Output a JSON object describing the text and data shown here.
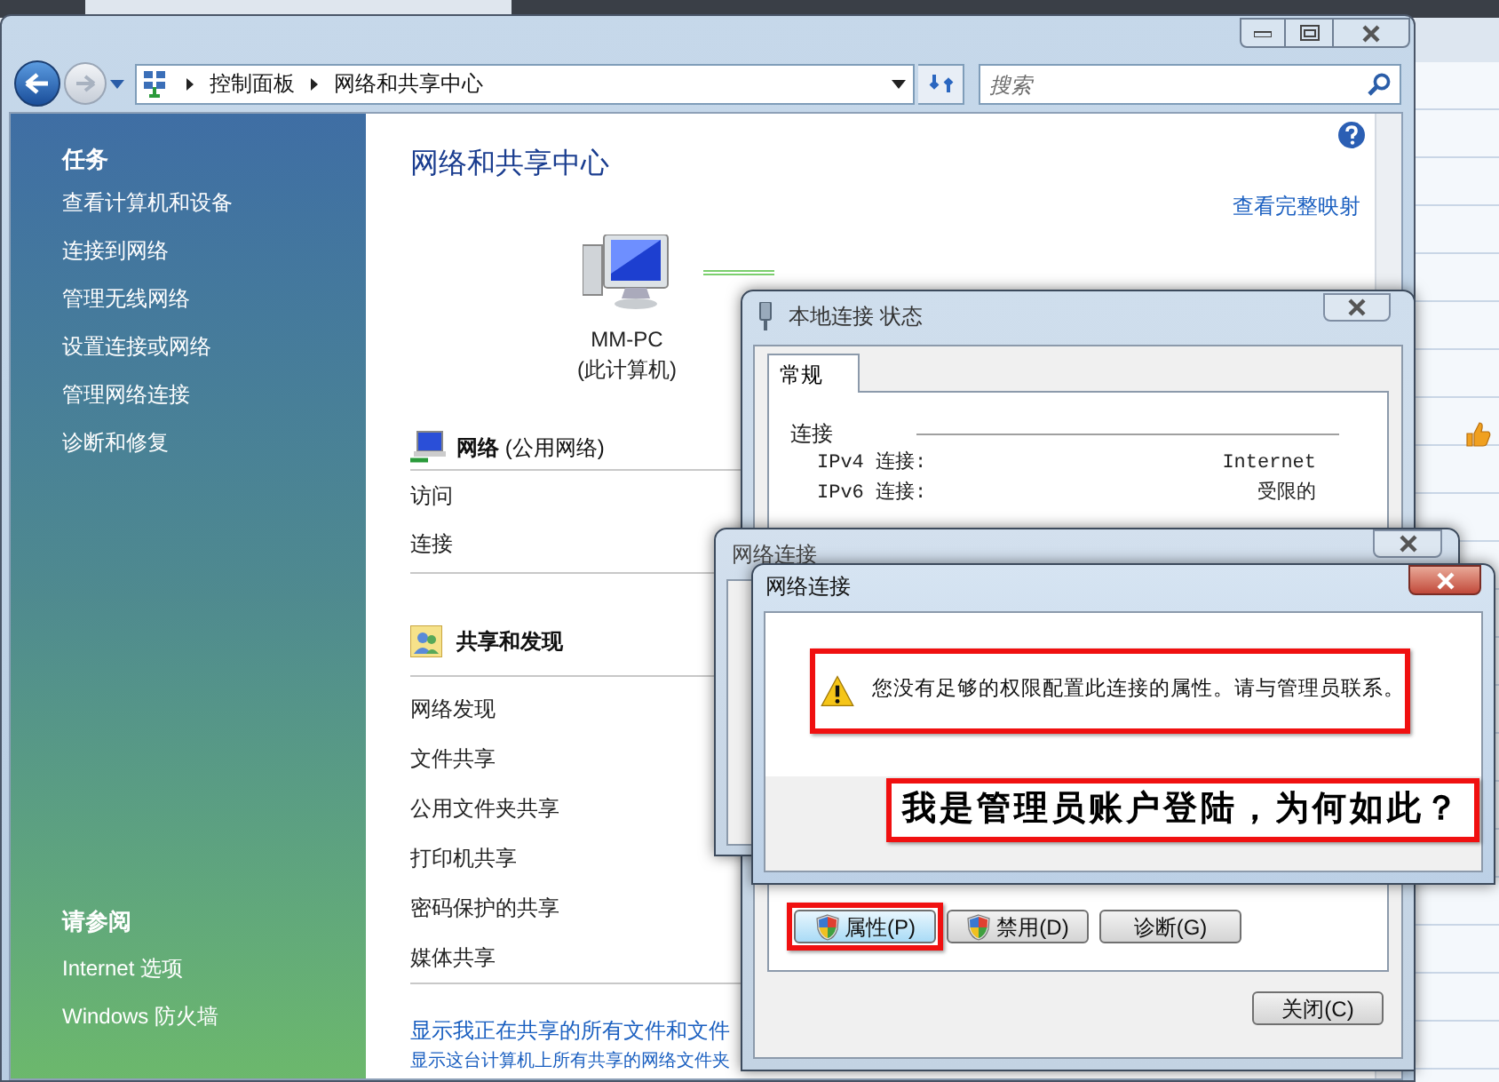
{
  "window": {
    "breadcrumb": [
      "控制面板",
      "网络和共享中心"
    ],
    "search": {
      "placeholder": "搜索"
    }
  },
  "sidebar": {
    "tasks_heading": "任务",
    "tasks": [
      "查看计算机和设备",
      "连接到网络",
      "管理无线网络",
      "设置连接或网络",
      "管理网络连接",
      "诊断和修复"
    ],
    "see_also_heading": "请参阅",
    "see_also": [
      "Internet 选项",
      "Windows 防火墙"
    ]
  },
  "main": {
    "title": "网络和共享中心",
    "map_link": "查看完整映射",
    "computer": {
      "name": "MM-PC",
      "caption": "(此计算机)"
    },
    "network": {
      "name": "网络",
      "type": "(公用网络)",
      "rows": [
        "访问",
        "连接"
      ]
    },
    "sharing": {
      "heading": "共享和发现",
      "rows": [
        "网络发现",
        "文件共享",
        "公用文件夹共享",
        "打印机共享",
        "密码保护的共享",
        "媒体共享"
      ]
    },
    "links": [
      "显示我正在共享的所有文件和文件",
      "显示这台计算机上所有共享的网络文件夹"
    ]
  },
  "status_dialog": {
    "title": "本地连接 状态",
    "tabs": [
      {
        "label": "常规",
        "selected": true
      }
    ],
    "group": "连接",
    "rows": [
      {
        "label": "IPv4 连接:",
        "value": "Internet"
      },
      {
        "label": "IPv6 连接:",
        "value": "受限的"
      }
    ],
    "buttons": [
      {
        "label": "属性(P)",
        "shield": true,
        "highlighted": true
      },
      {
        "label": "禁用(D)",
        "shield": true,
        "highlighted": false
      },
      {
        "label": "诊断(G)",
        "shield": false,
        "highlighted": false
      }
    ],
    "close": "关闭(C)"
  },
  "back_dialog": {
    "title": "网络连接"
  },
  "error_dialog": {
    "title": "网络连接",
    "message": "您没有足够的权限配置此连接的属性。请与管理员联系。",
    "highlighted": true
  },
  "annotation": "我是管理员账户登陆，为何如此？"
}
